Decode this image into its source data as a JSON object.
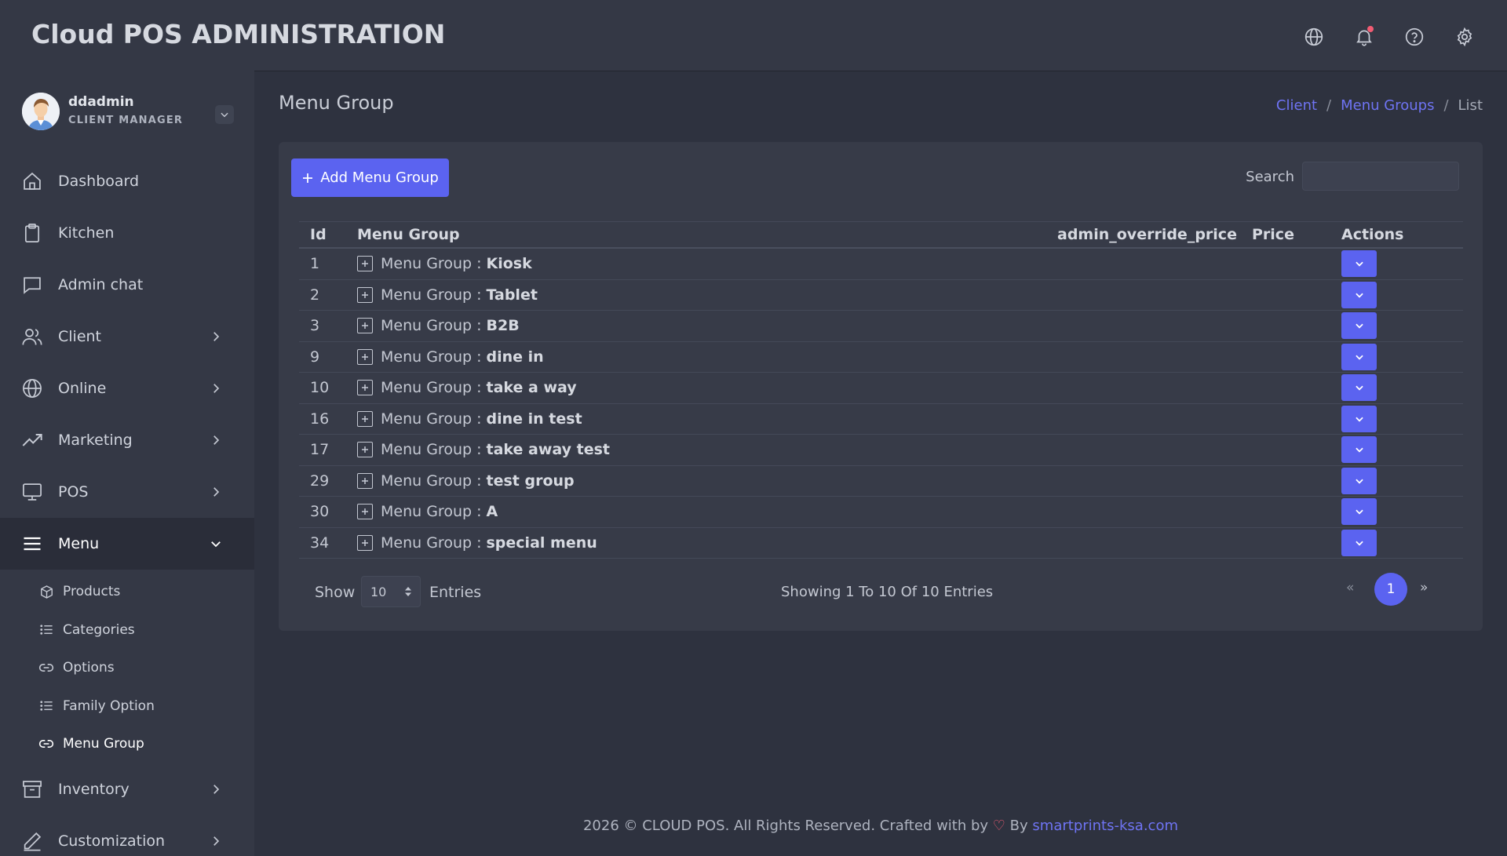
{
  "app": {
    "title": "Cloud POS ADMINISTRATION"
  },
  "header_icons": [
    "globe-icon",
    "bell-icon",
    "help-icon",
    "settings-icon"
  ],
  "user": {
    "name": "ddadmin",
    "role": "CLIENT MANAGER"
  },
  "sidebar": {
    "items": [
      {
        "label": "Dashboard",
        "icon": "home-icon"
      },
      {
        "label": "Kitchen",
        "icon": "clipboard-icon"
      },
      {
        "label": "Admin chat",
        "icon": "chat-icon"
      },
      {
        "label": "Client",
        "icon": "users-icon"
      },
      {
        "label": "Online",
        "icon": "globe-icon"
      },
      {
        "label": "Marketing",
        "icon": "trending-up-icon"
      },
      {
        "label": "POS",
        "icon": "monitor-icon"
      },
      {
        "label": "Menu",
        "icon": "menu-icon"
      },
      {
        "label": "Inventory",
        "icon": "archive-icon"
      },
      {
        "label": "Customization",
        "icon": "pen-icon"
      }
    ],
    "menu_sub": [
      {
        "label": "Products",
        "icon": "box-icon"
      },
      {
        "label": "Categories",
        "icon": "list-icon"
      },
      {
        "label": "Options",
        "icon": "link-icon"
      },
      {
        "label": "Family Option",
        "icon": "list-icon"
      },
      {
        "label": "Menu Group",
        "icon": "link-icon"
      }
    ]
  },
  "page": {
    "title": "Menu Group",
    "breadcrumb": [
      "Client",
      "Menu Groups",
      "List"
    ]
  },
  "toolbar": {
    "add_label": "Add Menu Group",
    "search_label": "Search",
    "search_value": ""
  },
  "table": {
    "columns": [
      "Id",
      "Menu Group",
      "admin_override_price",
      "Price",
      "Actions"
    ],
    "group_prefix": "Menu Group :",
    "rows": [
      {
        "id": "1",
        "name": "Kiosk"
      },
      {
        "id": "2",
        "name": "Tablet"
      },
      {
        "id": "3",
        "name": "B2B"
      },
      {
        "id": "9",
        "name": "dine in"
      },
      {
        "id": "10",
        "name": "take a way"
      },
      {
        "id": "16",
        "name": "dine in test"
      },
      {
        "id": "17",
        "name": "take away test"
      },
      {
        "id": "29",
        "name": "test group"
      },
      {
        "id": "30",
        "name": "A"
      },
      {
        "id": "34",
        "name": "special menu"
      }
    ]
  },
  "pagination": {
    "show_label": "Show",
    "entries_value": "10",
    "entries_label": "Entries",
    "summary": "Showing 1 To 10 Of 10 Entries",
    "prev": "«",
    "current": "1",
    "next": "»"
  },
  "footer": {
    "text": "2026 © CLOUD POS. All Rights Reserved. Crafted with by",
    "by": "By",
    "link": "smartprints-ksa.com"
  },
  "colors": {
    "accent": "#5b63f0",
    "link": "#6f74f4",
    "heart": "#f25c73"
  }
}
